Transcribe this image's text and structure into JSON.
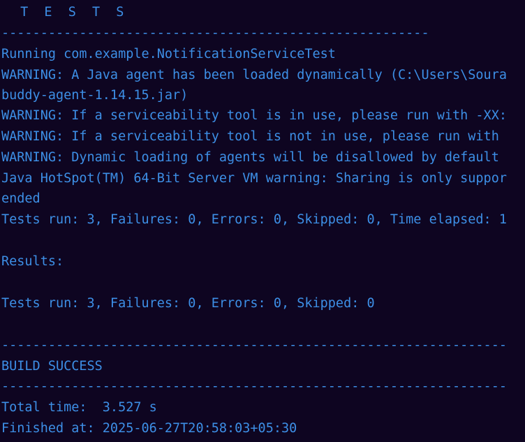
{
  "terminal": {
    "lines": {
      "header": " T E S T S",
      "sep1": "-------------------------------------------------------",
      "running": "Running com.example.NotificationServiceTest",
      "warn1": "WARNING: A Java agent has been loaded dynamically (C:\\Users\\Soura",
      "warn1b": "buddy-agent-1.14.15.jar)",
      "warn2": "WARNING: If a serviceability tool is in use, please run with -XX:",
      "warn3": "WARNING: If a serviceability tool is not in use, please run with",
      "warn4": "WARNING: Dynamic loading of agents will be disallowed by default",
      "vm_warn": "Java HotSpot(TM) 64-Bit Server VM warning: Sharing is only suppor",
      "vm_warn_b": "ended",
      "tests_run_1": "Tests run: 3, Failures: 0, Errors: 0, Skipped: 0, Time elapsed: 1",
      "results": "Results:",
      "tests_run_2": "Tests run: 3, Failures: 0, Errors: 0, Skipped: 0",
      "sep2": "-----------------------------------------------------------------",
      "build": "BUILD SUCCESS",
      "sep3": "-----------------------------------------------------------------",
      "total_time": "Total time:  3.527 s",
      "finished": "Finished at: 2025-06-27T20:58:03+05:30"
    }
  }
}
